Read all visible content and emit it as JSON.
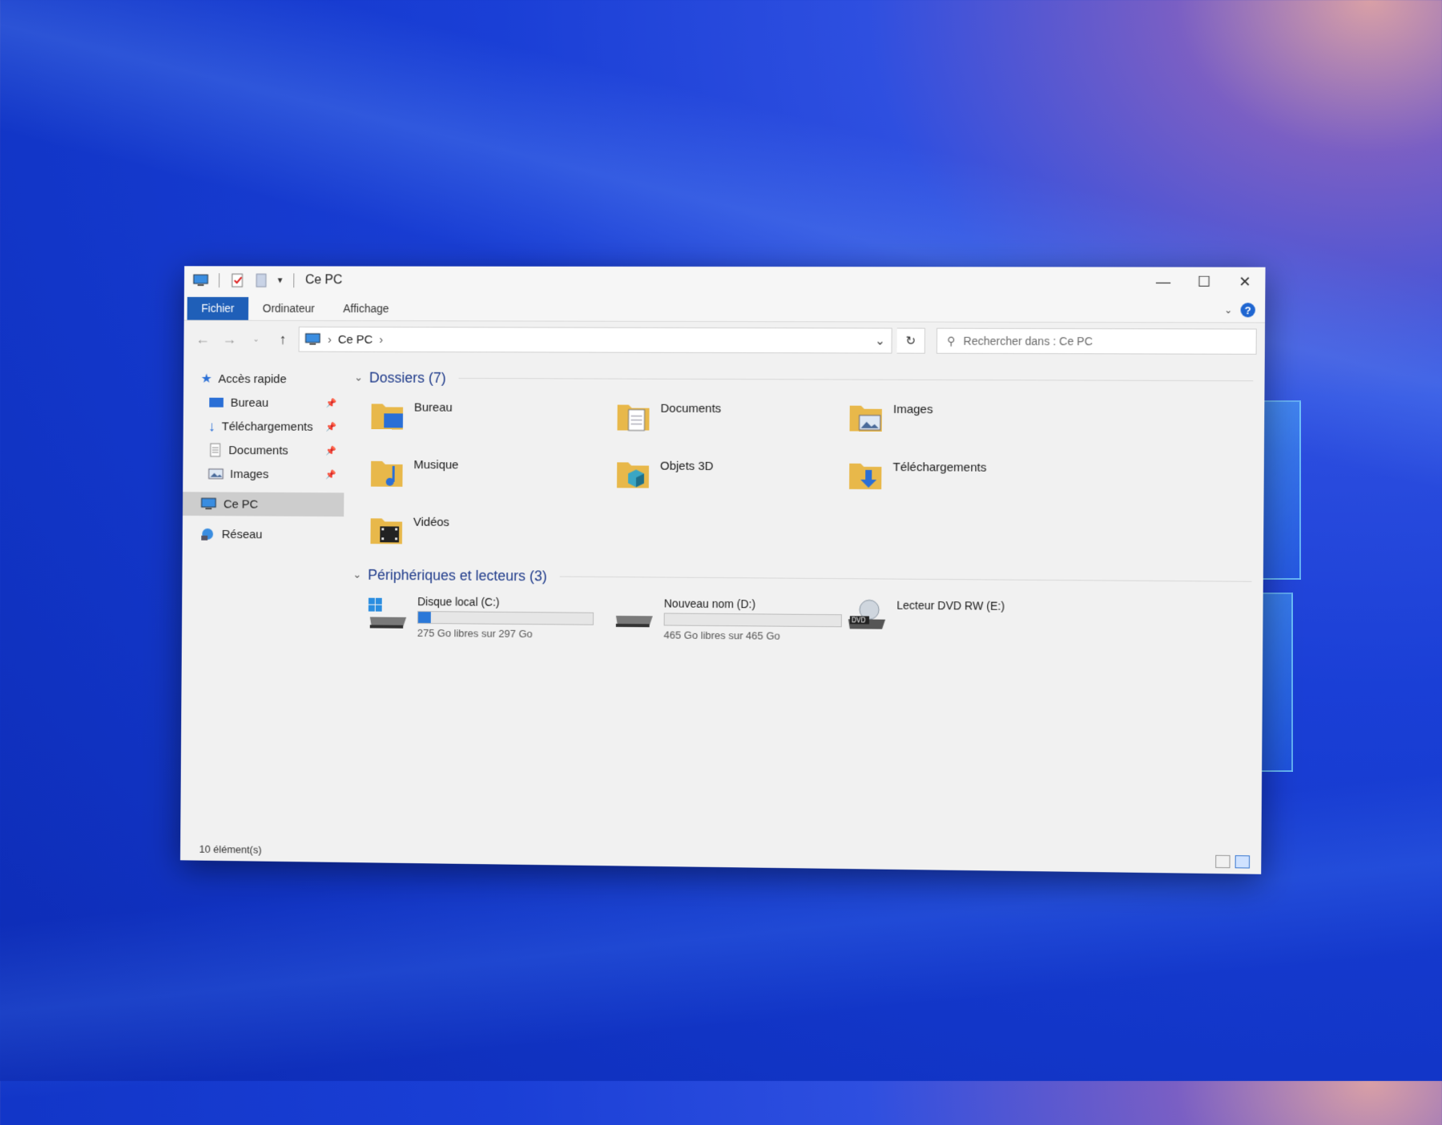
{
  "window": {
    "title": "Ce PC"
  },
  "ribbon": {
    "tabs": [
      "Fichier",
      "Ordinateur",
      "Affichage"
    ]
  },
  "address": {
    "location": "Ce PC",
    "search_placeholder": "Rechercher dans : Ce PC"
  },
  "sidebar": {
    "quick_access": "Accès rapide",
    "pinned": [
      {
        "label": "Bureau",
        "icon": "desktop-icon"
      },
      {
        "label": "Téléchargements",
        "icon": "download-icon"
      },
      {
        "label": "Documents",
        "icon": "documents-icon"
      },
      {
        "label": "Images",
        "icon": "images-icon"
      }
    ],
    "this_pc": "Ce PC",
    "network": "Réseau"
  },
  "folders_group": {
    "title": "Dossiers (7)",
    "items": [
      "Bureau",
      "Documents",
      "Images",
      "Musique",
      "Objets 3D",
      "Téléchargements",
      "Vidéos"
    ]
  },
  "drives_group": {
    "title": "Périphériques et lecteurs (3)",
    "items": [
      {
        "name": "Disque local (C:)",
        "free": "275 Go libres sur 297 Go",
        "used_fraction": 0.074
      },
      {
        "name": "Nouveau nom (D:)",
        "free": "465 Go libres sur 465 Go",
        "used_fraction": 0.0
      },
      {
        "name": "Lecteur DVD RW (E:)"
      }
    ]
  },
  "status": {
    "count": "10 élément(s)"
  },
  "colors": {
    "accent": "#1f5fb8",
    "folder": "#e8b84a",
    "desktop": "#1a3fd6"
  }
}
